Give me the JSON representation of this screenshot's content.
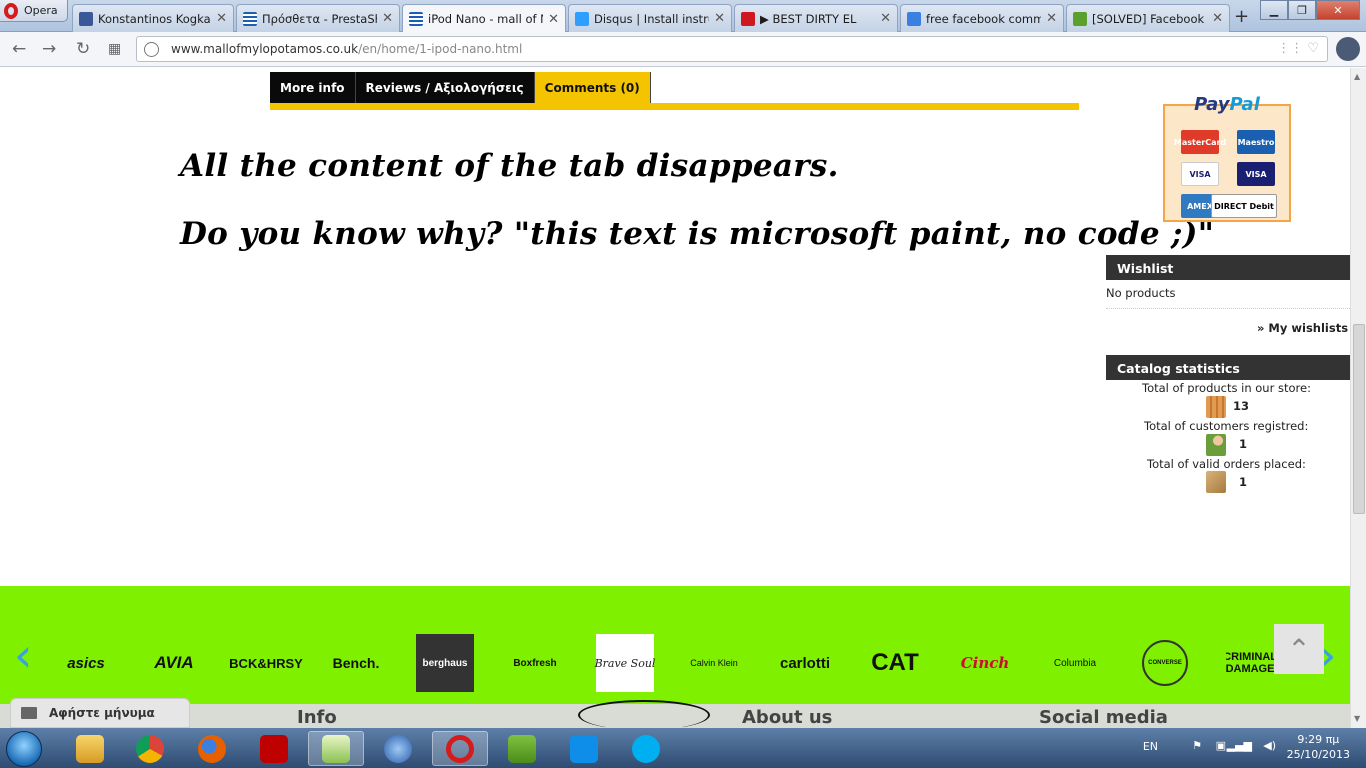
{
  "browser": {
    "menu_label": "Opera",
    "tabs": [
      {
        "title": "Konstantinos Kogkalid",
        "favicon_color": "#3b5998"
      },
      {
        "title": "Πρόσθετα - PrestaSh",
        "favicon_color": "#1b5fb0"
      },
      {
        "title": "iPod Nano - mall of M",
        "favicon_color": "#1b5fb0"
      },
      {
        "title": "Disqus | Install instruc",
        "favicon_color": "#2e9fff"
      },
      {
        "title": "▶ BEST DIRTY EL",
        "favicon_color": "#cc181e"
      },
      {
        "title": "free facebook comm",
        "favicon_color": "#3b7fe0"
      },
      {
        "title": "[SOLVED] Facebook c",
        "favicon_color": "#5aa02c"
      }
    ],
    "new_tab": "+",
    "url_host": "www.mallofmylopotamos.co.uk",
    "url_path": "/en/home/1-ipod-nano.html"
  },
  "product_tabs": [
    {
      "label": "More info"
    },
    {
      "label": "Reviews / Αξιολογήσεις"
    },
    {
      "label": "Comments (0)"
    }
  ],
  "annotation": {
    "line1": "All the content of the tab disappears.",
    "line2": "Do you know why? \"this text is microsoft paint, no code ;)\""
  },
  "paypal": {
    "logo_a": "Pay",
    "logo_b": "Pal",
    "cards": [
      "MasterCard",
      "Maestro",
      "VISA",
      "VISA",
      "AMEX",
      "DIRECT Debit"
    ]
  },
  "wishlist": {
    "heading": "Wishlist",
    "empty": "No products",
    "link": "» My wishlists"
  },
  "catalog_stats": {
    "heading": "Catalog statistics",
    "products_label": "Total of products in our store:",
    "products_value": "13",
    "customers_label": "Total of customers registred:",
    "customers_value": "1",
    "orders_label": "Total of valid orders placed:",
    "orders_value": "1"
  },
  "brands": [
    "asics",
    "AVIA",
    "BCK&HRSY",
    "Bench.",
    "berghaus",
    "Boxfresh",
    "Brave Soul",
    "Calvin Klein",
    "carlotti",
    "CAT",
    "Cinch",
    "Columbia",
    "CONVERSE",
    "CRIMINAL DAMAGE"
  ],
  "footer": {
    "message_label": "Αφήστε μήνυμα",
    "info": "Info",
    "about": "About us",
    "social": "Social media"
  },
  "taskbar": {
    "language": "EN",
    "time": "9:29 πμ",
    "date": "25/10/2013"
  }
}
